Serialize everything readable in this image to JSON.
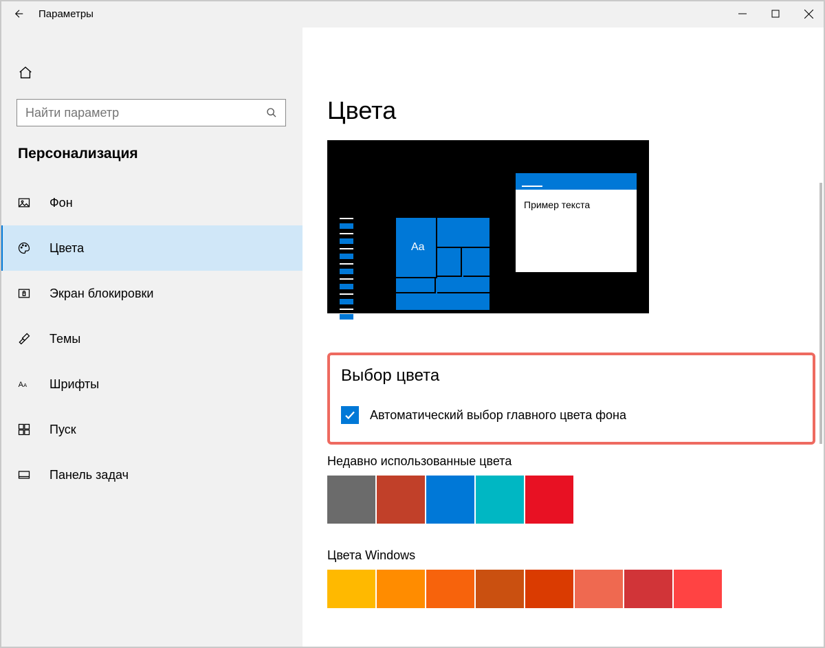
{
  "window": {
    "title": "Параметры"
  },
  "search": {
    "placeholder": "Найти параметр"
  },
  "section": "Персонализация",
  "nav": [
    {
      "label": "Фон"
    },
    {
      "label": "Цвета"
    },
    {
      "label": "Экран блокировки"
    },
    {
      "label": "Темы"
    },
    {
      "label": "Шрифты"
    },
    {
      "label": "Пуск"
    },
    {
      "label": "Панель задач"
    }
  ],
  "page": {
    "title": "Цвета",
    "preview_sample": "Пример текста",
    "preview_aa": "Aa",
    "color_pick_heading": "Выбор цвета",
    "auto_color_label": "Автоматический выбор главного цвета фона",
    "recent_heading": "Недавно использованные цвета",
    "recent_colors": [
      "#6b6b6b",
      "#c14029",
      "#0078d7",
      "#00b7c3",
      "#e81123"
    ],
    "windows_heading": "Цвета Windows",
    "windows_colors": [
      "#ffb900",
      "#ff8c00",
      "#f7630c",
      "#ca5010",
      "#da3b01",
      "#ef6950",
      "#d13438",
      "#ff4343"
    ]
  }
}
